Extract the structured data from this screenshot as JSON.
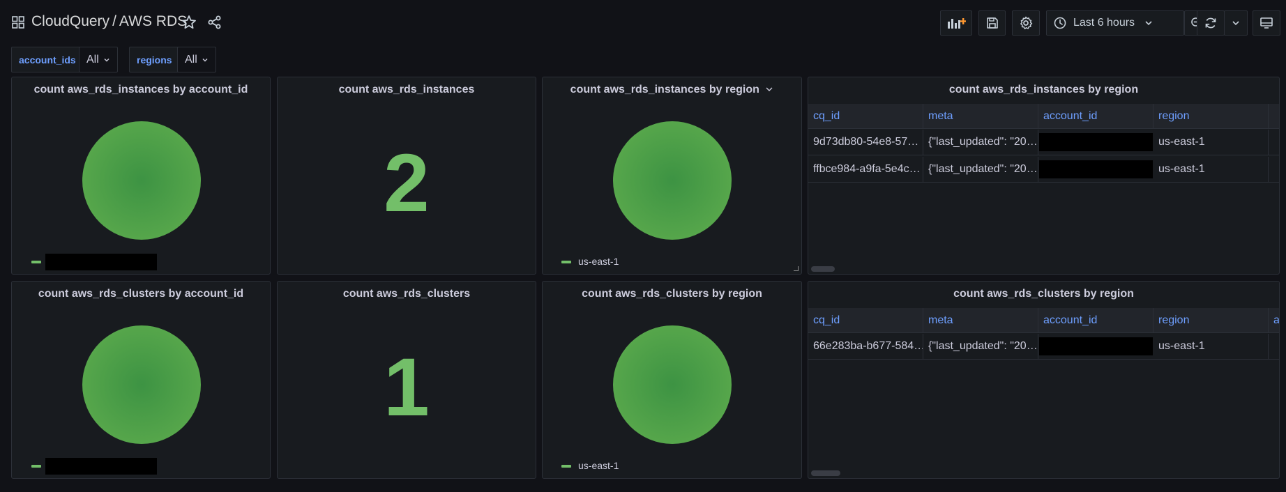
{
  "header": {
    "folder": "CloudQuery",
    "separator": "/",
    "dashboard": "AWS RDS",
    "time_range": "Last 6 hours"
  },
  "variables": [
    {
      "label": "account_ids",
      "value": "All"
    },
    {
      "label": "regions",
      "value": "All"
    }
  ],
  "panels": {
    "instances_by_account": {
      "title": "count aws_rds_instances by account_id"
    },
    "instances_count": {
      "title": "count aws_rds_instances",
      "value": "2"
    },
    "instances_by_region": {
      "title": "count aws_rds_instances by region",
      "legend": "us-east-1"
    },
    "instances_table": {
      "title": "count aws_rds_instances by region",
      "columns": [
        "cq_id",
        "meta",
        "account_id",
        "region"
      ],
      "rows": [
        [
          "9d73db80-54e8-57…",
          "{\"last_updated\": \"20…",
          "",
          "us-east-1"
        ],
        [
          "ffbce984-a9fa-5e4c…",
          "{\"last_updated\": \"20…",
          "",
          "us-east-1"
        ]
      ]
    },
    "clusters_by_account": {
      "title": "count aws_rds_clusters by account_id"
    },
    "clusters_count": {
      "title": "count aws_rds_clusters",
      "value": "1"
    },
    "clusters_by_region": {
      "title": "count aws_rds_clusters by region",
      "legend": "us-east-1"
    },
    "clusters_table": {
      "title": "count aws_rds_clusters by region",
      "columns": [
        "cq_id",
        "meta",
        "account_id",
        "region",
        "a"
      ],
      "rows": [
        [
          "66e283ba-b677-584…",
          "{\"last_updated\": \"20…",
          "",
          "us-east-1"
        ]
      ]
    }
  },
  "colors": {
    "series_green": "#73bf69",
    "link_blue": "#6e9fff",
    "background": "#111217"
  }
}
